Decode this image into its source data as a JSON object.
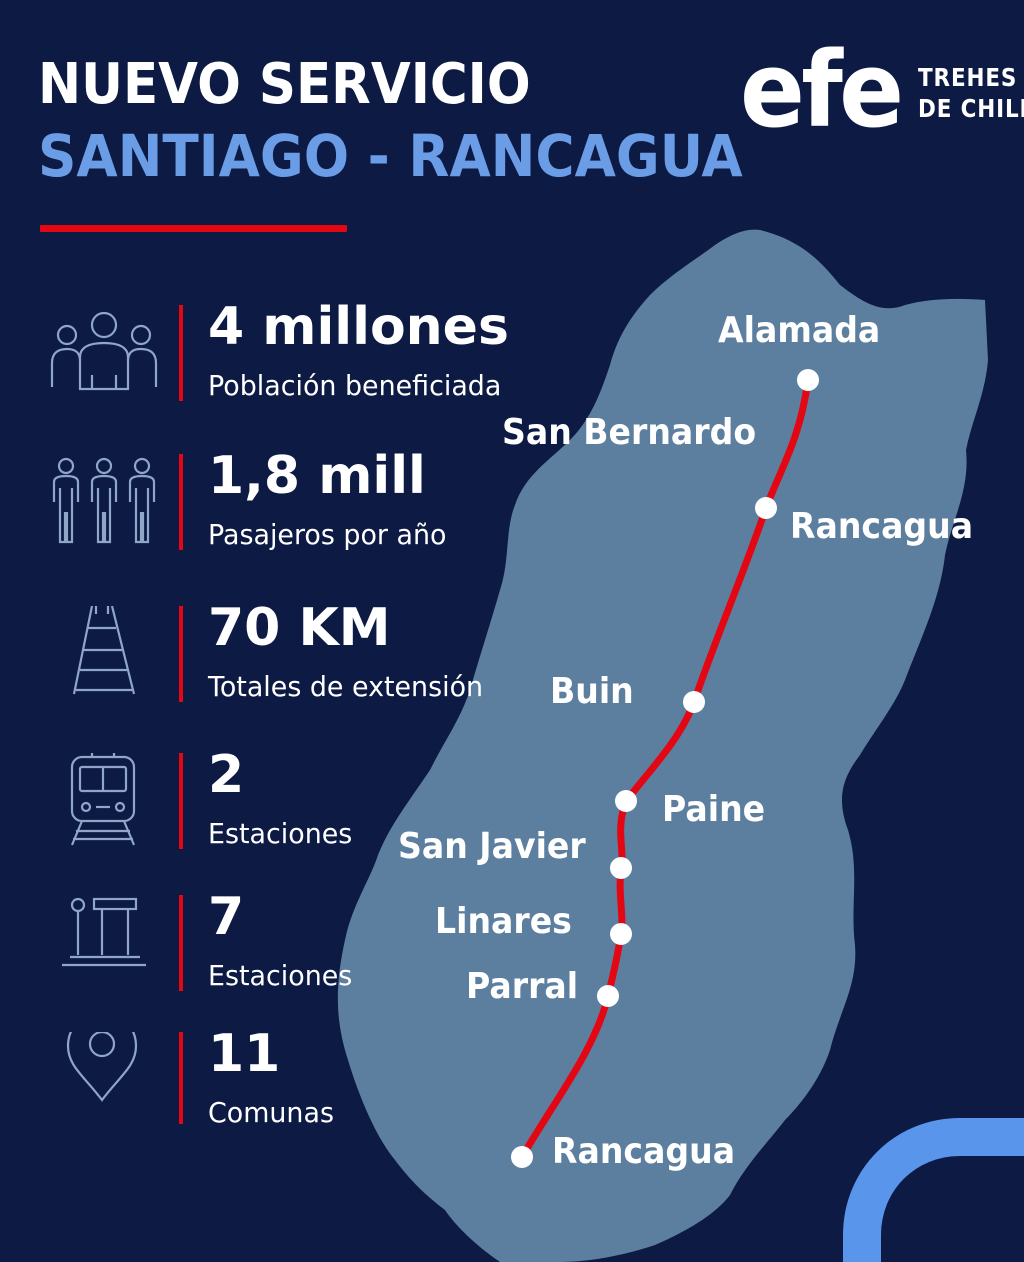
{
  "header": {
    "title_line1": "NUEVO SERVICIO",
    "title_line2": "SANTIAGO - RANCAGUA"
  },
  "logo": {
    "mark": "efe",
    "line1": "TREHES",
    "line2": "DE CHILE"
  },
  "stats": [
    {
      "value": "4 millones",
      "label": "Población beneficiada",
      "icon": "population-icon"
    },
    {
      "value": "1,8 mill",
      "label": "Pasajeros por año",
      "icon": "passengers-icon"
    },
    {
      "value": "70 KM",
      "label": "Totales de extensión",
      "icon": "railway-track-icon"
    },
    {
      "value": "2",
      "label": "Estaciones",
      "icon": "train-icon"
    },
    {
      "value": "7",
      "label": "Estaciones",
      "icon": "station-icon"
    },
    {
      "value": "11",
      "label": "Comunas",
      "icon": "location-pin-icon"
    }
  ],
  "map": {
    "stations": [
      "Alamada",
      "San Bernardo",
      "Rancagua",
      "Buin",
      "Paine",
      "San Javier",
      "Linares",
      "Parral",
      "Rancagua"
    ]
  },
  "colors": {
    "background": "#0c1a44",
    "accent_red": "#e30613",
    "accent_blue": "#6a9de6",
    "map_fill": "#5d7f9f"
  }
}
